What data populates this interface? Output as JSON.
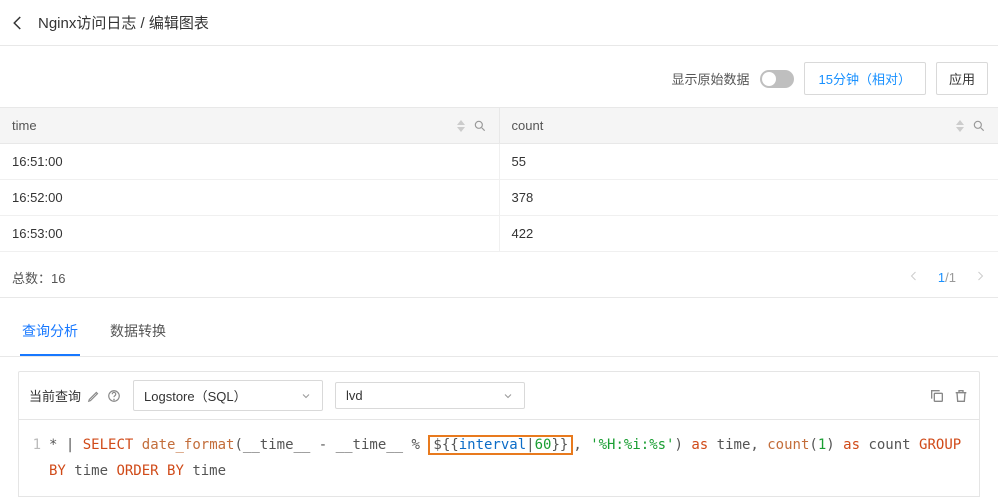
{
  "breadcrumb": "Nginx访问日志 / 编辑图表",
  "toolbar": {
    "raw_data_label": "显示原始数据",
    "timerange_label": "15分钟（相对）",
    "apply_label": "应用"
  },
  "table": {
    "columns": [
      "time",
      "count"
    ],
    "rows": [
      {
        "time": "16:51:00",
        "count": "55"
      },
      {
        "time": "16:52:00",
        "count": "378"
      },
      {
        "time": "16:53:00",
        "count": "422"
      }
    ],
    "total_label": "总数：",
    "total_value": "16",
    "page_current": "1",
    "page_total": "1"
  },
  "tabs": {
    "analysis": "查询分析",
    "transform": "数据转换"
  },
  "query": {
    "label": "当前查询",
    "source_select": "Logstore（SQL）",
    "logstore_select": "lvd",
    "sql": {
      "star": "*",
      "pipe": "|",
      "select": "SELECT",
      "func": "date_format",
      "time_id": "__time__",
      "minus": "-",
      "pct": "%",
      "var_open": "${{",
      "var_name": "interval",
      "var_pipe": "|",
      "var_default": "60",
      "var_close": "}}",
      "comma": ",",
      "fmt_str": "'%H:%i:%s'",
      "as": "as",
      "alias_time": "time",
      "count_func": "count",
      "one": "1",
      "alias_count": "count",
      "groupby": "GROUP BY",
      "orderby": "ORDER BY"
    }
  }
}
